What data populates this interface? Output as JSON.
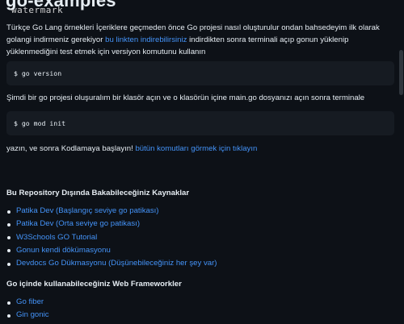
{
  "repo": {
    "title": "go-examples"
  },
  "watermark": "watermark",
  "intro": {
    "part1": "Türkçe Go Lang örnekleri İçeriklere geçmeden önce Go projesi nasıl oluşturulur ondan bahsedeyim ilk olarak golangi indirmeniz gerekiyor ",
    "link": "bu linkten indirebilirsiniz",
    "part2": " indirdikten sonra terminali açıp gonun yüklenip yüklenmediğini test etmek için versiyon komutunu kullanın"
  },
  "code1": "$ go version",
  "para2": "Şimdi bir go projesi oluşuralım bir klasör açın ve o klasörün içine main.go dosyanızı açın sonra terminale",
  "code2": "$ go mod init",
  "para3": {
    "text": "yazın, ve sonra Kodlamaya başlayın! ",
    "link": "bütün komutları görmek için tıklayın"
  },
  "resources": {
    "heading": "Bu Repository Dışında Bakabileceğiniz Kaynaklar",
    "items": [
      "Patika Dev (Başlangıç seviye go patikası)",
      "Patika Dev (Orta seviye go patikası)",
      "W3Schools GO Tutorial",
      "Gonun kendi dökümasyonu",
      "Devdocs Go Dükmasyonu (Düşünebileceğiniz her şey var)"
    ]
  },
  "frameworks": {
    "heading": "Go içinde kullanabileceğiniz Web Frameworkler",
    "items": [
      "Go fiber",
      "Gin gonic"
    ]
  },
  "colors": {
    "background": "#0d1117",
    "text": "#e6edf3",
    "link": "#4493f8",
    "code_bg": "#161b22"
  }
}
